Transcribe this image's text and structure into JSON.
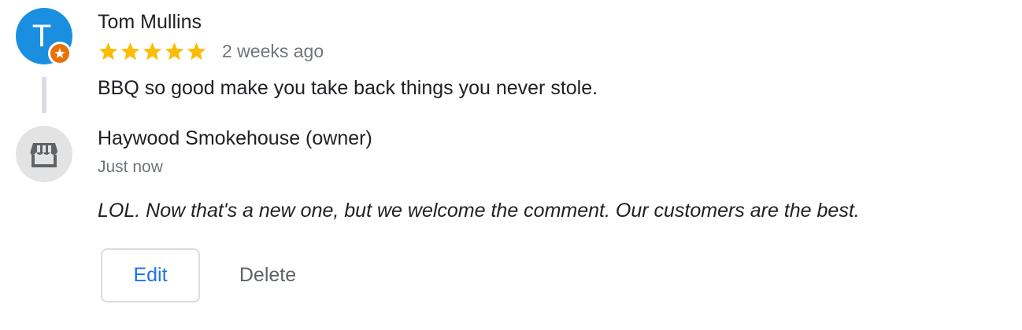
{
  "review": {
    "avatar_letter": "T",
    "avatar_color": "#1a8fe0",
    "badge_icon": "local-guide-star-icon",
    "badge_color": "#e8710a",
    "reviewer_name": "Tom Mullins",
    "rating": 5,
    "rating_max": 5,
    "star_color": "#fbbc04",
    "time": "2 weeks ago",
    "text": "BBQ so good make you take back things you never stole."
  },
  "reply": {
    "avatar_icon": "storefront-icon",
    "owner_name": "Haywood Smokehouse (owner)",
    "time": "Just now",
    "text": "LOL. Now that's a new one, but we welcome the comment. Our customers are the best."
  },
  "actions": {
    "edit_label": "Edit",
    "delete_label": "Delete",
    "edit_color": "#1a73e8"
  }
}
